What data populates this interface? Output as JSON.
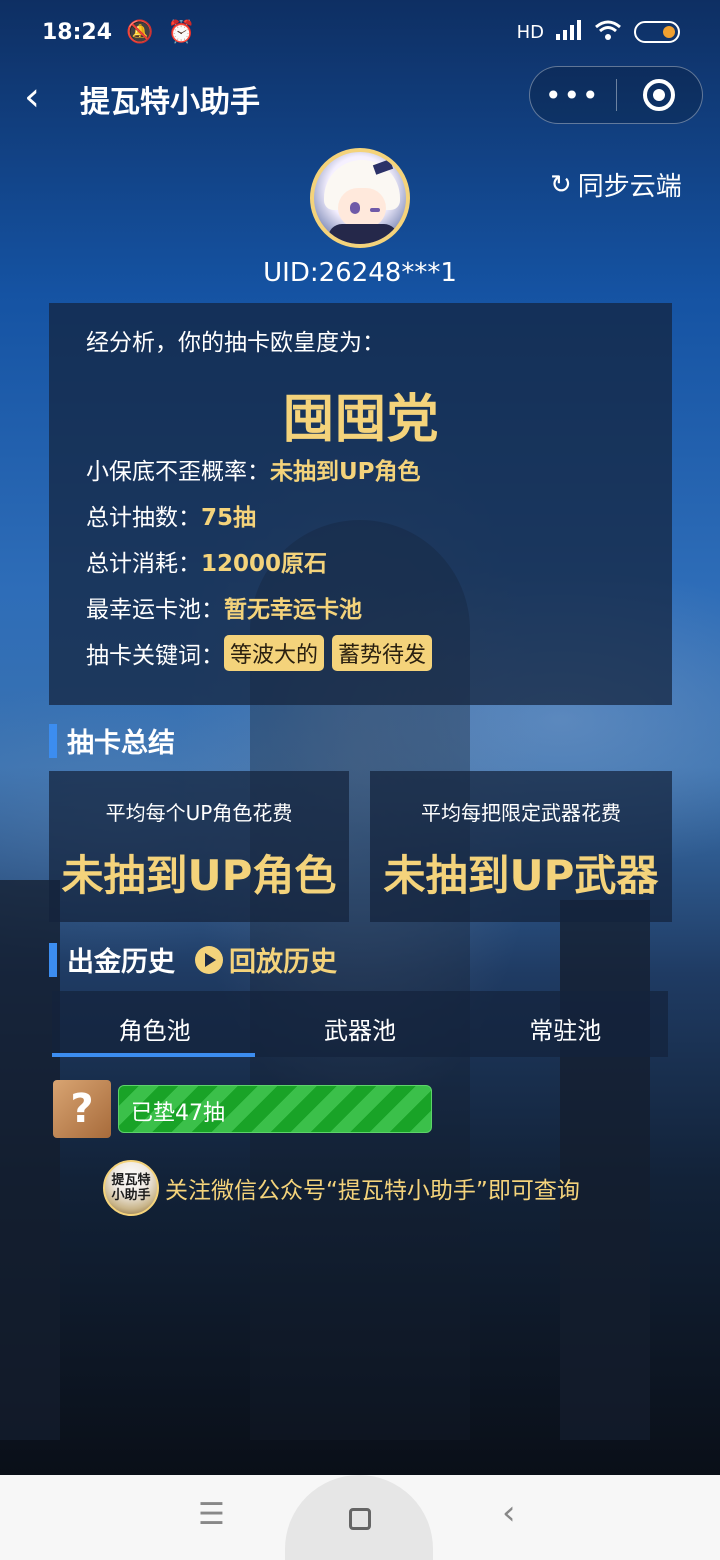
{
  "status_bar": {
    "time": "18:24",
    "icons": [
      "bell-off-icon",
      "alarm-icon"
    ],
    "right": {
      "network": "HD",
      "signal_icon": "signal-icon",
      "wifi_icon": "wifi-icon",
      "battery_icon": "battery-icon"
    }
  },
  "nav": {
    "title": "提瓦特小助手",
    "more_glyph": "•••",
    "back_glyph": "‹"
  },
  "profile": {
    "uid": "UID:26248***1",
    "sync_label": "同步云端",
    "sync_icon": "↻"
  },
  "analysis": {
    "intro": "经分析，你的抽卡欧皇度为：",
    "title": "囤囤党",
    "rows": [
      {
        "label": "小保底不歪概率：",
        "value": "未抽到UP角色"
      },
      {
        "label": "总计抽数：",
        "value": "75抽"
      },
      {
        "label": "总计消耗：",
        "value": "12000原石"
      },
      {
        "label": "最幸运卡池：",
        "value": "暂无幸运卡池"
      }
    ],
    "keywords_label": "抽卡关键词：",
    "keywords": [
      "等波大的",
      "蓄势待发"
    ]
  },
  "summary": {
    "section_title": "抽卡总结",
    "cards": [
      {
        "label": "平均每个UP角色花费",
        "value": "未抽到UP角色"
      },
      {
        "label": "平均每把限定武器花费",
        "value": "未抽到UP武器"
      }
    ]
  },
  "history": {
    "section_title": "出金历史",
    "replay_label": "回放历史",
    "tabs": [
      "角色池",
      "武器池",
      "常驻池"
    ],
    "active_tab": 0,
    "unknown_glyph": "?",
    "pity_text": "已垫47抽"
  },
  "footer": {
    "logo_text_1": "提瓦特",
    "logo_text_2": "小助手",
    "note": "关注微信公众号“提瓦特小助手”即可查询"
  },
  "system_nav": {
    "menu_glyph": "☰",
    "back_glyph": "‹"
  },
  "colors": {
    "accent_gold": "#f4d37b",
    "accent_blue": "#3c8df0",
    "pity_green": "#19a327"
  }
}
